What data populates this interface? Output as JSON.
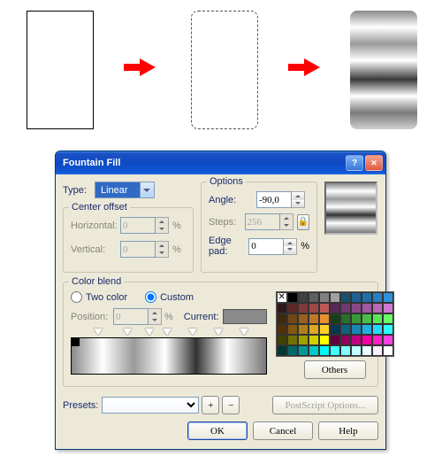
{
  "dialog": {
    "title": "Fountain Fill",
    "type_label": "Type:",
    "type_value": "Linear",
    "center_offset": {
      "legend": "Center offset",
      "horizontal_label": "Horizontal:",
      "horizontal_value": "0",
      "vertical_label": "Vertical:",
      "vertical_value": "0",
      "pct": "%"
    },
    "options": {
      "legend": "Options",
      "angle_label": "Angle:",
      "angle_value": "-90,0",
      "steps_label": "Steps:",
      "steps_value": "256",
      "edgepad_label": "Edge pad:",
      "edgepad_value": "0",
      "pct": "%"
    },
    "color_blend": {
      "legend": "Color blend",
      "two_color": "Two color",
      "custom": "Custom",
      "position_label": "Position:",
      "position_value": "0",
      "pct": "%",
      "current_label": "Current:",
      "others": "Others"
    },
    "presets_label": "Presets:",
    "postscript": "PostScript Options...",
    "ok": "OK",
    "cancel": "Cancel",
    "help": "Help"
  },
  "palette": [
    null,
    "#000000",
    "#404040",
    "#606060",
    "#808080",
    "#a0a0a0",
    "#185070",
    "#206090",
    "#2070a8",
    "#2880c0",
    "#3090d8",
    "#301818",
    "#602828",
    "#803838",
    "#a04848",
    "#c05858",
    "#582858",
    "#703870",
    "#884888",
    "#a058a0",
    "#b868b8",
    "#d078d0",
    "#402810",
    "#704818",
    "#986020",
    "#c07828",
    "#e89030",
    "#184018",
    "#287028",
    "#389838",
    "#48c048",
    "#58e858",
    "#68ff68",
    "#503008",
    "#805810",
    "#b08018",
    "#e0a820",
    "#ffd028",
    "#083850",
    "#106080",
    "#1888b0",
    "#20b0e0",
    "#28d8ff",
    "#30ffff",
    "#404000",
    "#707000",
    "#a0a000",
    "#d0d000",
    "#ffff00",
    "#600040",
    "#900060",
    "#c00080",
    "#f000a0",
    "#ff20c0",
    "#ff40e0",
    "#003838",
    "#006868",
    "#009898",
    "#00c8c8",
    "#00f8f8",
    "#40ffff",
    "#80ffff",
    "#c0ffff",
    "#e8ffff",
    "#f8f0ff",
    "#ffffff"
  ]
}
